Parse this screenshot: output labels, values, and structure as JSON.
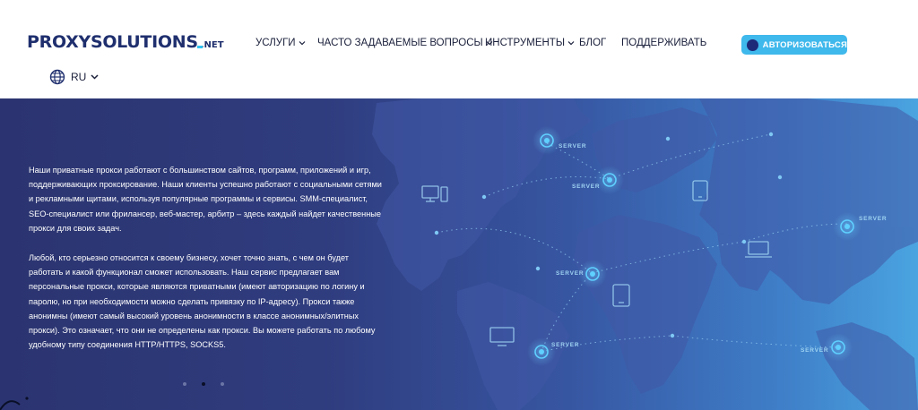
{
  "header": {
    "logo": {
      "main": "PROXYSOLUTIONS",
      "suffix": ".NET"
    },
    "nav": [
      {
        "label": "УСЛУГИ",
        "dropdown": true
      },
      {
        "label": "ЧАСТО ЗАДАВАЕМЫЕ ВОПРОСЫ",
        "dropdown": true
      },
      {
        "label": "ИНСТРУМЕНТЫ",
        "dropdown": true
      },
      {
        "label": "БЛОГ",
        "dropdown": false
      },
      {
        "label": "ПОДДЕРЖИВАТЬ",
        "dropdown": false
      }
    ],
    "auth_button": "АВТОРИЗОВАТЬСЯ",
    "language": "RU"
  },
  "hero": {
    "paragraphs": [
      "Наши приватные прокси работают с большинством сайтов, программ, приложений и игр, поддерживающих проксирование. Наши клиенты успешно работают с социальными сетями и рекламными щитами, используя популярные программы и сервисы. SMM-специалист, SEO-специалист или фрилансер, веб-мастер, арбитр – здесь каждый найдет качественные прокси для своих задач.",
      "Любой, кто серьезно относится к своему бизнесу, хочет точно знать, с чем он будет работать и какой функционал сможет использовать. Наш сервис предлагает вам персональные прокси, которые являются приватными (имеют авторизацию по логину и паролю, но при необходимости можно сделать привязку по IP-адресу). Прокси также анонимны (имеют самый высокий уровень анонимности в классе анонимных/элитных прокси). Это означает, что они не определены как прокси. Вы можете работать по любому удобному типу соединения HTTP/HTTPS, SOCKS5."
    ],
    "server_label": "SERVER",
    "slider": {
      "count": 3,
      "active": 2
    }
  },
  "colors": {
    "brand_navy": "#1f2f6e",
    "accent_cyan": "#3fb8ec",
    "hero_left": "#2b3470",
    "hero_right": "#4aa4e0"
  }
}
